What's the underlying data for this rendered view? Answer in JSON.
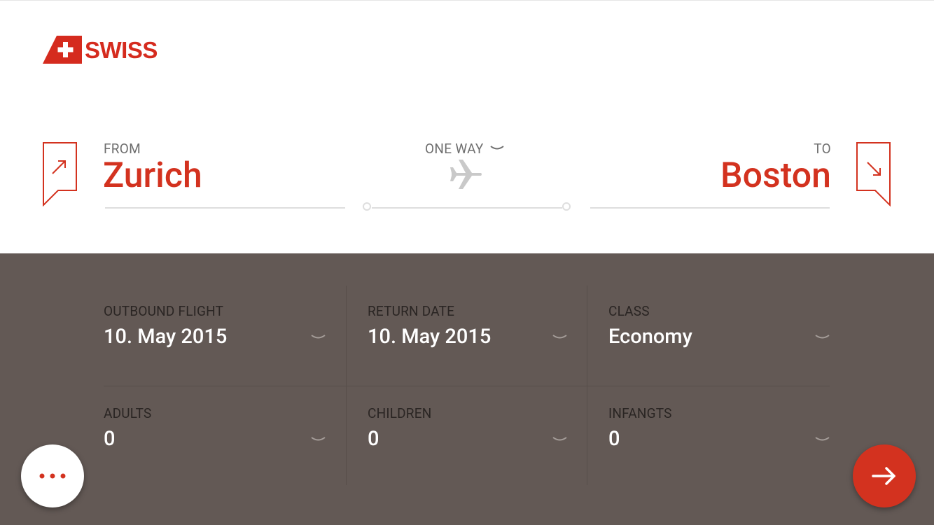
{
  "brand": {
    "name": "SWISS",
    "color": "#d52b1e"
  },
  "route": {
    "from_label": "FROM",
    "from_city": "Zurich",
    "to_label": "TO",
    "to_city": "Boston",
    "trip_type": "ONE WAY",
    "plane_icon": "plane-icon"
  },
  "booking": {
    "outbound": {
      "label": "OUTBOUND FLIGHT",
      "value": "10. May 2015"
    },
    "return": {
      "label": "RETURN DATE",
      "value": "10. May 2015"
    },
    "class": {
      "label": "CLASS",
      "value": "Economy"
    },
    "adults": {
      "label": "ADULTS",
      "value": "0"
    },
    "children": {
      "label": "CHILDREN",
      "value": "0"
    },
    "infants": {
      "label": "INFANGTS",
      "value": "0"
    }
  },
  "actions": {
    "more_icon": "more-dots-icon",
    "submit_icon": "arrow-right-icon"
  },
  "colors": {
    "accent": "#d3321f",
    "panel": "#635955",
    "white": "#ffffff"
  }
}
